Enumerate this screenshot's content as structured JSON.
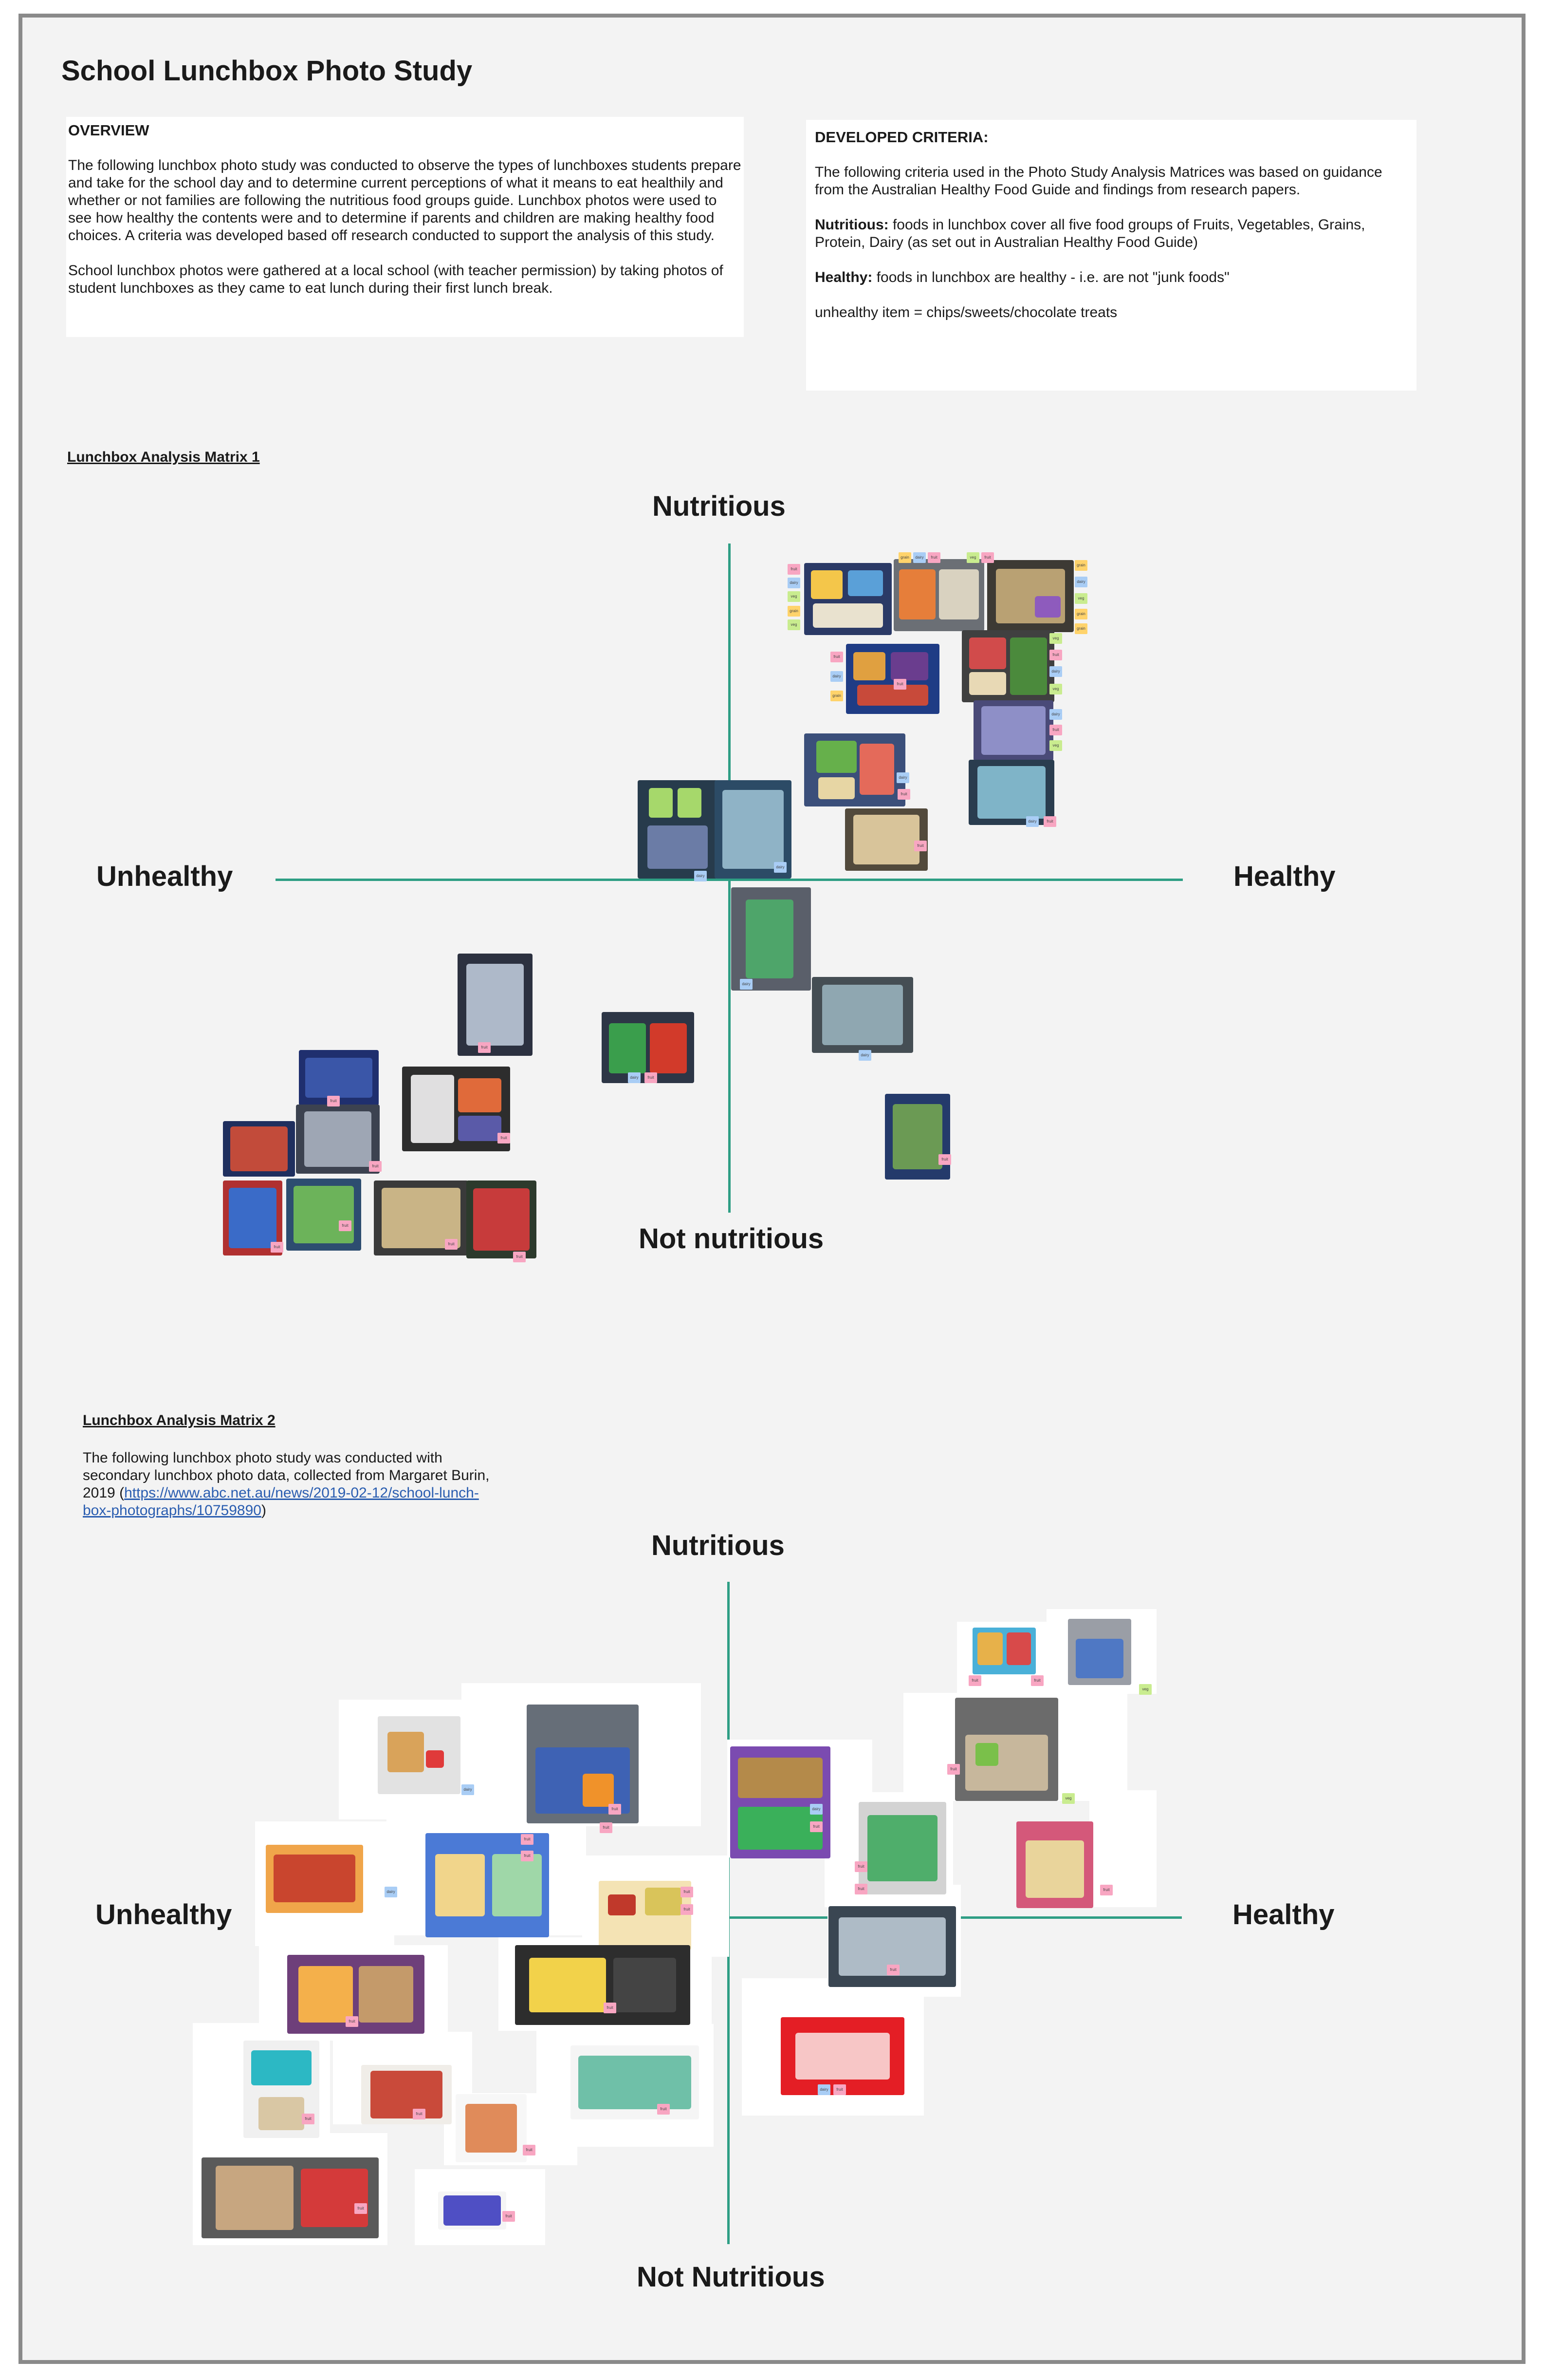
{
  "title": "School Lunchbox Photo Study",
  "overview": {
    "heading": "OVERVIEW",
    "paragraphs": [
      "The following lunchbox photo study was conducted to observe the types of lunchboxes students prepare and take for the school day and to determine current perceptions of what it means to eat healthily and whether or not families are following the nutritious food groups guide. Lunchbox photos were used to see how healthy the contents were and to determine if parents and children are making healthy food choices. A criteria was developed based off research conducted to support the analysis of this study.",
      "School lunchbox photos were gathered at a local school (with teacher permission) by taking photos of student lunchboxes as they came to eat lunch during their first lunch break."
    ]
  },
  "criteria": {
    "heading": "DEVELOPED CRITERIA:",
    "intro": "The following criteria used in the Photo Study Analysis Matrices was based on guidance from the Australian Healthy Food Guide and findings from research papers.",
    "nutritious_term": "Nutritious:",
    "nutritious_text": " foods in lunchbox cover all five food groups of Fruits, Vegetables, Grains, Protein, Dairy (as set out in Australian Healthy Food Guide)",
    "healthy_term": "Healthy:",
    "healthy_text": " foods in lunchbox are healthy - i.e. are not \"junk foods\"",
    "unhealthy_note": "unhealthy item = chips/sweets/chocolate treats"
  },
  "matrix1": {
    "title": "Lunchbox Analysis Matrix 1",
    "axis": {
      "top": "Nutritious",
      "bottom": "Not nutritious",
      "left": "Unhealthy",
      "right": "Healthy"
    }
  },
  "matrix2": {
    "title": "Lunchbox Analysis Matrix 2",
    "intro_text": "The following lunchbox photo study was conducted with secondary lunchbox photo data, collected from Margaret Burin, 2019 (",
    "intro_link": "https://www.abc.net.au/news/2019-02-12/school-lunch-box-photographs/10759890",
    "intro_close": ")",
    "axis": {
      "top": "Nutritious",
      "bottom": "Not Nutritious",
      "left": "Unhealthy",
      "right": "Healthy"
    }
  },
  "sticky_labels": {
    "fruit": "fruit",
    "dairy": "dairy",
    "veg": "veg",
    "grain": "grain"
  },
  "colors": {
    "axis": "#2e9e84",
    "board": "#f3f3f3",
    "border": "#8a8a8a",
    "fruit_note": "#f8a6c2",
    "dairy_note": "#a9cdf5",
    "veg_note": "#c9ec8f",
    "grain_note": "#ffd36b",
    "link": "#2a5db0"
  }
}
